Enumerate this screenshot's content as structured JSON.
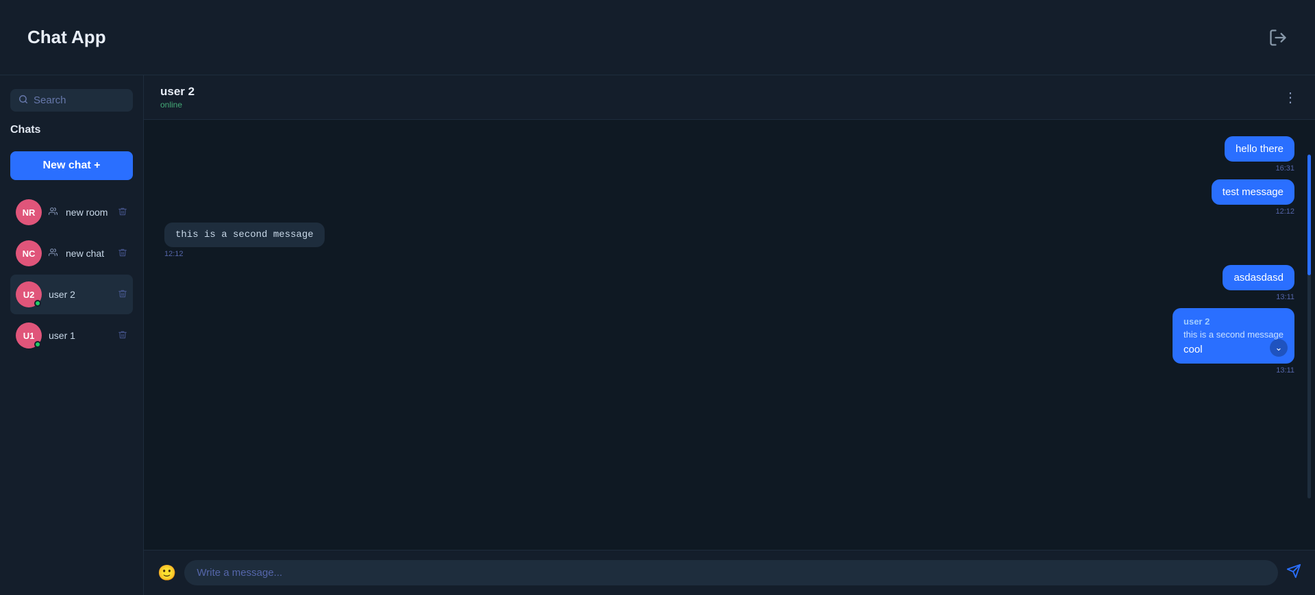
{
  "app": {
    "title": "Chat App"
  },
  "sidebar": {
    "search_placeholder": "Search",
    "chats_label": "Chats",
    "new_chat_label": "New chat +",
    "items": [
      {
        "id": "new-room",
        "initials": "NR",
        "name": "new room",
        "avatar_class": "nr",
        "group": true,
        "online": false
      },
      {
        "id": "new-chat",
        "initials": "NC",
        "name": "new chat",
        "avatar_class": "nc",
        "group": true,
        "online": false
      },
      {
        "id": "user-2",
        "initials": "U2",
        "name": "user 2",
        "avatar_class": "u2",
        "group": false,
        "online": true,
        "active": true
      },
      {
        "id": "user-1",
        "initials": "U1",
        "name": "user 1",
        "avatar_class": "u1",
        "group": false,
        "online": true,
        "active": false
      }
    ]
  },
  "chat": {
    "header": {
      "name": "user 2",
      "status": "online"
    },
    "messages": [
      {
        "id": "m1",
        "type": "sent",
        "text": "hello there",
        "time": "16:31"
      },
      {
        "id": "m2",
        "type": "sent",
        "text": "test message",
        "time": "12:12"
      },
      {
        "id": "m3",
        "type": "received",
        "text": "this is a second message",
        "time": "12:12"
      },
      {
        "id": "m4",
        "type": "sent",
        "text": "asdasdasd",
        "time": "13:11"
      },
      {
        "id": "m5",
        "type": "reply-sent",
        "reply_author": "user 2",
        "reply_quote": "this is a second message",
        "main_text": "cool",
        "time": "13:11"
      }
    ],
    "input_placeholder": "Write a message..."
  }
}
